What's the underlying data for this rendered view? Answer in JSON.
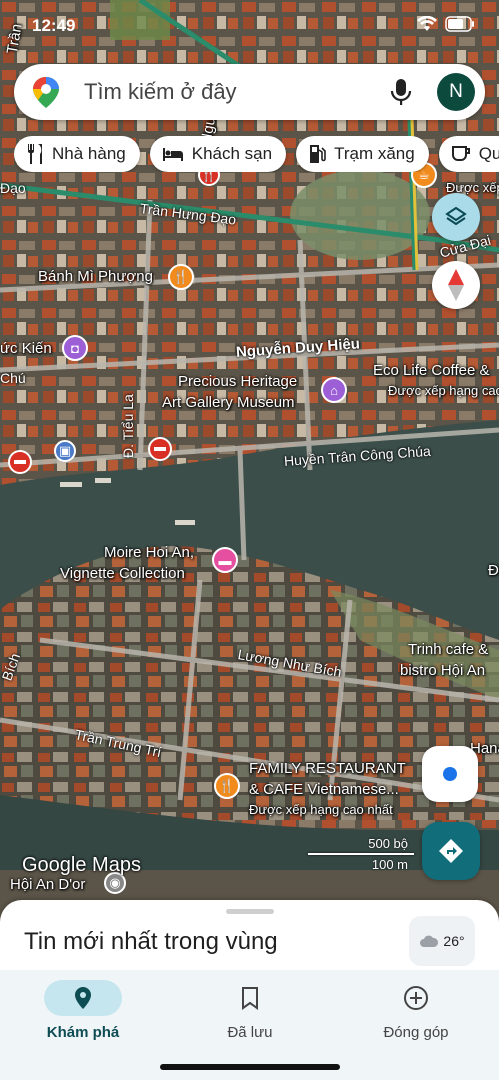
{
  "status_bar": {
    "time": "12:49"
  },
  "search": {
    "placeholder": "Tìm kiếm ở đây",
    "avatar_letter": "N"
  },
  "chips": [
    {
      "label": "Nhà hàng",
      "icon": "restaurant-icon"
    },
    {
      "label": "Khách sạn",
      "icon": "hotel-icon"
    },
    {
      "label": "Trạm xăng",
      "icon": "gas-station-icon"
    },
    {
      "label": "Qu",
      "icon": "coffee-icon"
    }
  ],
  "map": {
    "streets": {
      "tran_hung_dao": "Trần Hưng Đạo",
      "nguyen_duy_hieu": "Nguyễn Duy Hiệu",
      "huyen_tran_cong_chua": "Huyền Trân Công Chúa",
      "luong_nhu_bich": "Lương Như Bích",
      "tran_trung_tri": "Trần Trung Trí",
      "tieu_la": "Đ. Tiểu La",
      "cua_dai": "Cửa Đại",
      "dao": "Đạo",
      "bich": "Bích",
      "chu": "Chú",
      "tran_hung_dao_top": "Trần",
      "nguyen_top": "Nguy"
    },
    "places": {
      "banh_mi": "Bánh Mì Phượng",
      "duc_kien": "ức Kiến",
      "precious_1": "Precious Heritage",
      "precious_2": "Art Gallery Museum",
      "ecolife": "Eco Life Coffee &",
      "ecolife_sub": "Được xếp hạng cao",
      "top_right_sub": "Được xếp",
      "moire_1": "Moire Hoi An,",
      "moire_2": "Vignette Collection",
      "trinh_1": "Trinh cafe &",
      "trinh_2": "bistro Hội An",
      "family_1": "FAMILY RESTAURANT",
      "family_2": "& CAFE Vietnamese...",
      "family_sub": "Được xếp hạng cao nhất",
      "hoi_an_dor": "Hội An D'or",
      "right_edge_d": "Đ",
      "hana": "Hana"
    },
    "scale": {
      "top": "500 bộ",
      "bottom": "100 m"
    },
    "wordmark": "Google Maps"
  },
  "sheet": {
    "title": "Tin mới nhất trong vùng",
    "temperature": "26°"
  },
  "bottom_nav": [
    {
      "label": "Khám phá",
      "icon": "explore-pin-icon",
      "active": true
    },
    {
      "label": "Đã lưu",
      "icon": "bookmark-icon",
      "active": false
    },
    {
      "label": "Đóng góp",
      "icon": "add-circle-icon",
      "active": false
    }
  ]
}
